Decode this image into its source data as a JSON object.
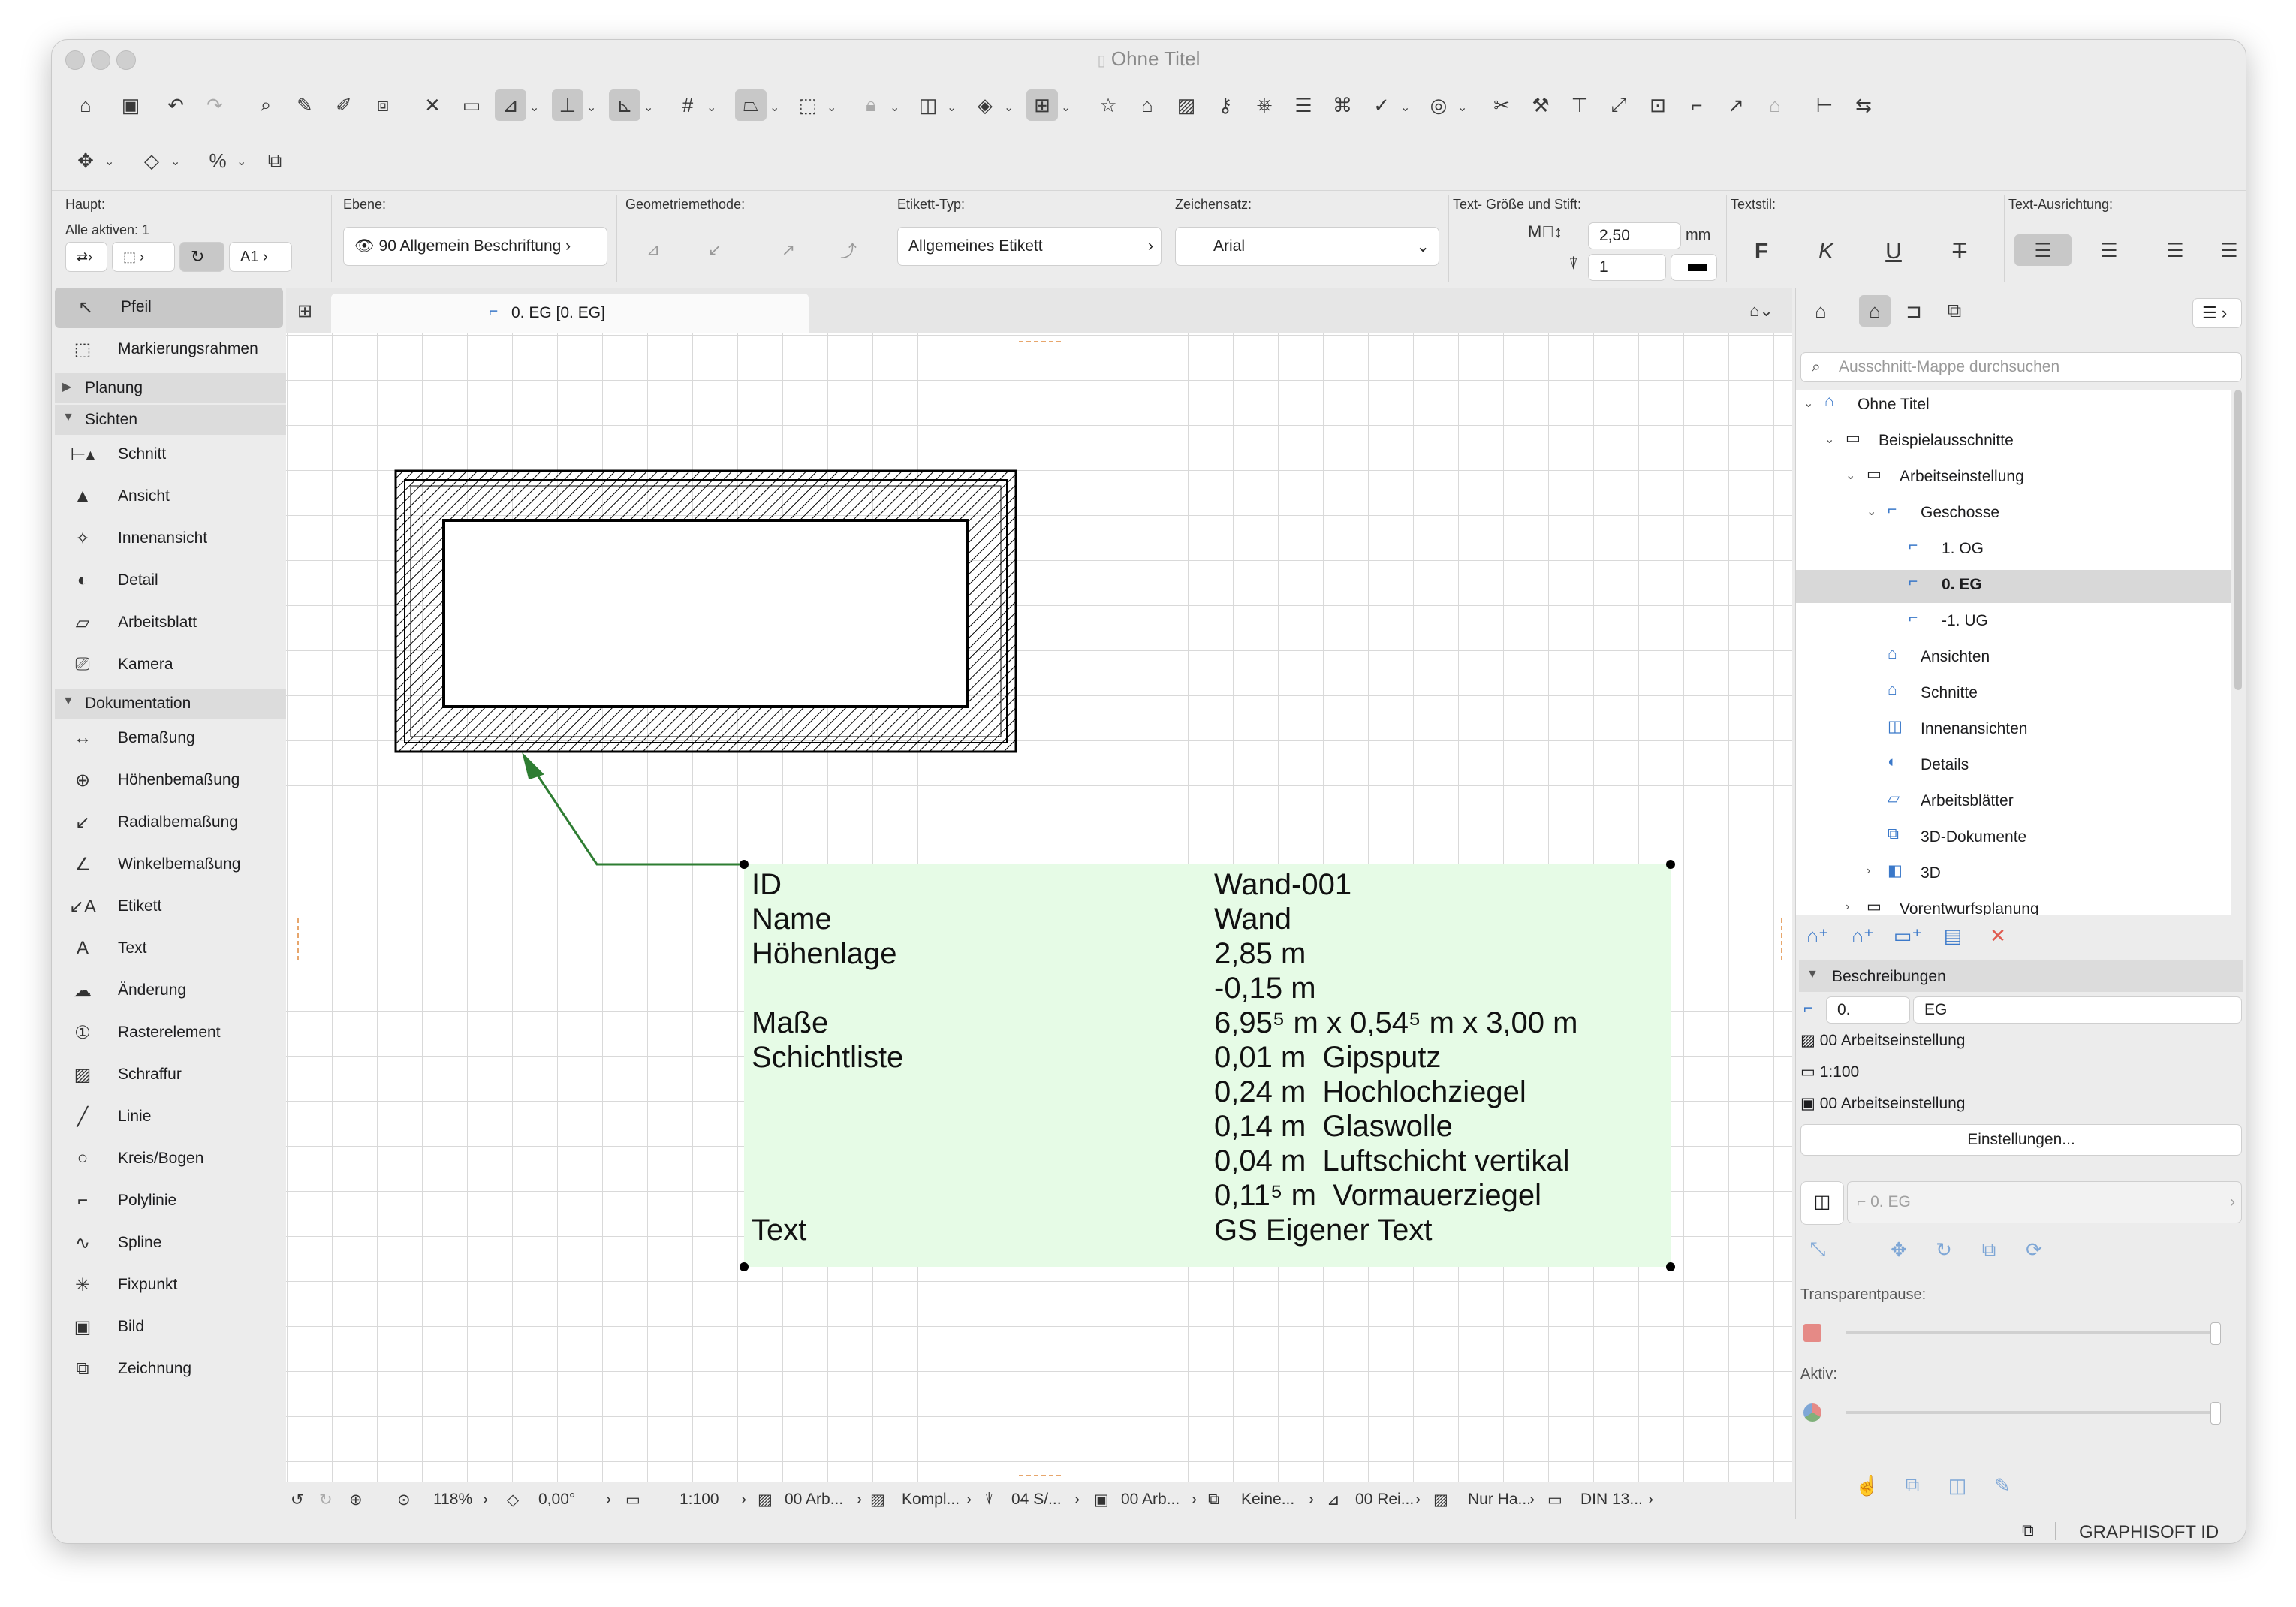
{
  "window": {
    "title": "Ohne Titel"
  },
  "infobox": {
    "haupt_label": "Haupt:",
    "alle_aktiven": "Alle aktiven: 1",
    "ebene_label": "Ebene:",
    "ebene_value": "90 Allgemein Beschriftung",
    "geometrie_label": "Geometriemethode:",
    "etikett_typ_label": "Etikett-Typ:",
    "etikett_typ_value": "Allgemeines Etikett",
    "zeichensatz_label": "Zeichensatz:",
    "zeichensatz_value": "Arial",
    "textgroesse_label": "Text- Größe und Stift:",
    "textgroesse_value": "2,50",
    "textgroesse_unit": "mm",
    "stift_value": "1",
    "textstil_label": "Textstil:",
    "textstil_buttons": [
      "F",
      "K",
      "U",
      "T"
    ],
    "ausrichtung_label": "Text-Ausrichtung:",
    "a1_label": "A1"
  },
  "sidebar": {
    "top_items": [
      {
        "label": "Pfeil",
        "icon": "arrow-pointer-icon",
        "selected": true
      },
      {
        "label": "Markierungsrahmen",
        "icon": "marquee-icon",
        "selected": false
      }
    ],
    "groups": [
      {
        "label": "Planung",
        "expanded": false,
        "items": []
      },
      {
        "label": "Sichten",
        "expanded": true,
        "items": [
          {
            "label": "Schnitt",
            "icon": "section-icon"
          },
          {
            "label": "Ansicht",
            "icon": "elevation-icon"
          },
          {
            "label": "Innenansicht",
            "icon": "interior-elevation-icon"
          },
          {
            "label": "Detail",
            "icon": "detail-icon"
          },
          {
            "label": "Arbeitsblatt",
            "icon": "worksheet-icon"
          },
          {
            "label": "Kamera",
            "icon": "camera-icon"
          }
        ]
      },
      {
        "label": "Dokumentation",
        "expanded": true,
        "items": [
          {
            "label": "Bemaßung",
            "icon": "dimension-icon"
          },
          {
            "label": "Höhenbemaßung",
            "icon": "level-dimension-icon"
          },
          {
            "label": "Radialbemaßung",
            "icon": "radial-dimension-icon"
          },
          {
            "label": "Winkelbemaßung",
            "icon": "angle-dimension-icon"
          },
          {
            "label": "Etikett",
            "icon": "label-icon"
          },
          {
            "label": "Text",
            "icon": "text-icon"
          },
          {
            "label": "Änderung",
            "icon": "change-icon"
          },
          {
            "label": "Rasterelement",
            "icon": "grid-element-icon"
          },
          {
            "label": "Schraffur",
            "icon": "fill-icon"
          },
          {
            "label": "Linie",
            "icon": "line-icon"
          },
          {
            "label": "Kreis/Bogen",
            "icon": "circle-icon"
          },
          {
            "label": "Polylinie",
            "icon": "polyline-icon"
          },
          {
            "label": "Spline",
            "icon": "spline-icon"
          },
          {
            "label": "Fixpunkt",
            "icon": "hotspot-icon"
          },
          {
            "label": "Bild",
            "icon": "image-icon"
          },
          {
            "label": "Zeichnung",
            "icon": "drawing-icon"
          }
        ]
      }
    ]
  },
  "tab": {
    "label": "0. EG [0. EG]"
  },
  "label_table": [
    {
      "key": "ID",
      "value": "Wand-001"
    },
    {
      "key": "Name",
      "value": "Wand"
    },
    {
      "key": "Höhenlage",
      "value": "2,85 m"
    },
    {
      "key": "",
      "value": "-0,15 m"
    },
    {
      "key": "Maße",
      "value": "6,95⁵ m x 0,54⁵ m x 3,00 m"
    },
    {
      "key": "Schichtliste",
      "value": "0,01 m  Gipsputz"
    },
    {
      "key": "",
      "value": "0,24 m  Hochlochziegel"
    },
    {
      "key": "",
      "value": "0,14 m  Glaswolle"
    },
    {
      "key": "",
      "value": "0,04 m  Luftschicht vertikal"
    },
    {
      "key": "",
      "value": "0,11⁵ m  Vormauerziegel"
    },
    {
      "key": "Text",
      "value": "GS Eigener Text"
    }
  ],
  "navigator": {
    "search_placeholder": "Ausschnitt-Mappe durchsuchen",
    "tree": [
      {
        "label": "Ohne Titel",
        "level": 0,
        "arrow": "down",
        "bold": false
      },
      {
        "label": "Beispielausschnitte",
        "level": 1,
        "arrow": "down",
        "bold": false
      },
      {
        "label": "Arbeitseinstellung",
        "level": 2,
        "arrow": "down",
        "bold": false
      },
      {
        "label": "Geschosse",
        "level": 3,
        "arrow": "down",
        "bold": false
      },
      {
        "label": "1. OG",
        "level": 4,
        "arrow": "",
        "bold": false
      },
      {
        "label": "0. EG",
        "level": 4,
        "arrow": "",
        "bold": true
      },
      {
        "label": "-1. UG",
        "level": 4,
        "arrow": "",
        "bold": false
      },
      {
        "label": "Ansichten",
        "level": 3,
        "arrow": "",
        "bold": false
      },
      {
        "label": "Schnitte",
        "level": 3,
        "arrow": "",
        "bold": false
      },
      {
        "label": "Innenansichten",
        "level": 3,
        "arrow": "",
        "bold": false
      },
      {
        "label": "Details",
        "level": 3,
        "arrow": "",
        "bold": false
      },
      {
        "label": "Arbeitsblätter",
        "level": 3,
        "arrow": "",
        "bold": false
      },
      {
        "label": "3D-Dokumente",
        "level": 3,
        "arrow": "",
        "bold": false
      },
      {
        "label": "3D",
        "level": 3,
        "arrow": "right",
        "bold": false
      },
      {
        "label": "Vorentwurfsplanung",
        "level": 2,
        "arrow": "right",
        "bold": false
      }
    ],
    "beschreibungen_label": "Beschreibungen",
    "id_value": "0.",
    "name_value": "EG",
    "arbeitseinstellung_1": "00 Arbeitseinstellung",
    "massstab": "1:100",
    "arbeitseinstellung_2": "00 Arbeitseinstellung",
    "einstellungen_button": "Einstellungen...",
    "pause_field": "0. EG",
    "transparentpause_label": "Transparentpause:",
    "aktiv_label": "Aktiv:"
  },
  "statusbar": {
    "zoom": "118%",
    "angle": "0,00°",
    "scale": "1:100",
    "layer_combo": "00 Arb...",
    "structure": "Kompl...",
    "pen_set": "04 S/...",
    "model_view": "00 Arb...",
    "renovation": "Keine...",
    "graphic_override": "00 Rei...",
    "partial_structure": "Nur Ha...",
    "dimension": "DIN 13..."
  },
  "footer": {
    "brand": "GRAPHISOFT ID"
  },
  "colors": {
    "label_bg": "#e6fbe6",
    "leader": "#2e7d32",
    "selected_tab": "#c8c8c8"
  }
}
